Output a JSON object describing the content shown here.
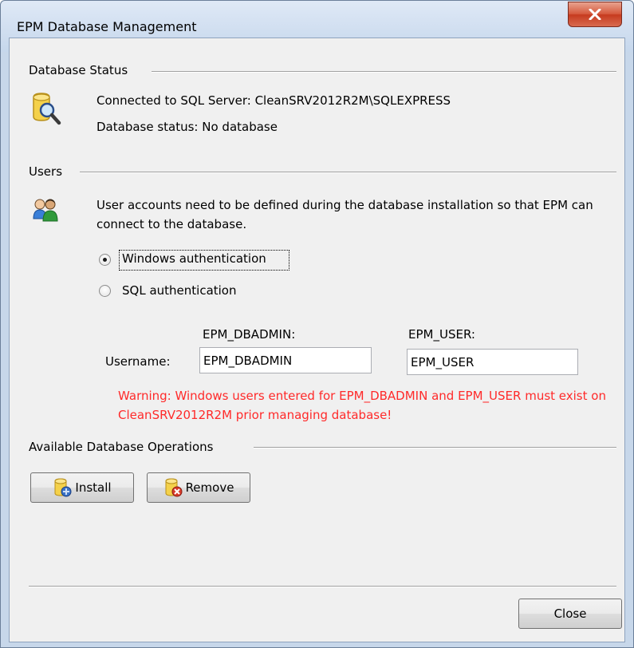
{
  "window": {
    "title": "EPM Database Management",
    "close_icon": "close-icon"
  },
  "database_status": {
    "section_title": "Database Status",
    "icon": "database-search-icon",
    "connected_text": "Connected to SQL Server:  CleanSRV2012R2M\\SQLEXPRESS",
    "status_text": "Database status:  No database"
  },
  "users": {
    "section_title": "Users",
    "icon": "users-icon",
    "description": "User accounts need to be defined during the database installation so that EPM can connect to the database.",
    "auth_options": [
      {
        "label": "Windows authentication",
        "selected": true
      },
      {
        "label": "SQL authentication",
        "selected": false
      }
    ],
    "dbadmin_header": "EPM_DBADMIN:",
    "user_header": "EPM_USER:",
    "username_label": "Username:",
    "dbadmin_value": "EPM_DBADMIN",
    "user_value": "EPM_USER",
    "warning": "Warning: Windows users entered for EPM_DBADMIN and EPM_USER must exist on CleanSRV2012R2M prior managing database!",
    "warning_color": "#ff2a2a"
  },
  "operations": {
    "section_title": "Available Database Operations",
    "install_label": "Install",
    "install_icon": "database-install-icon",
    "remove_label": "Remove",
    "remove_icon": "database-remove-icon"
  },
  "footer": {
    "close_label": "Close"
  }
}
